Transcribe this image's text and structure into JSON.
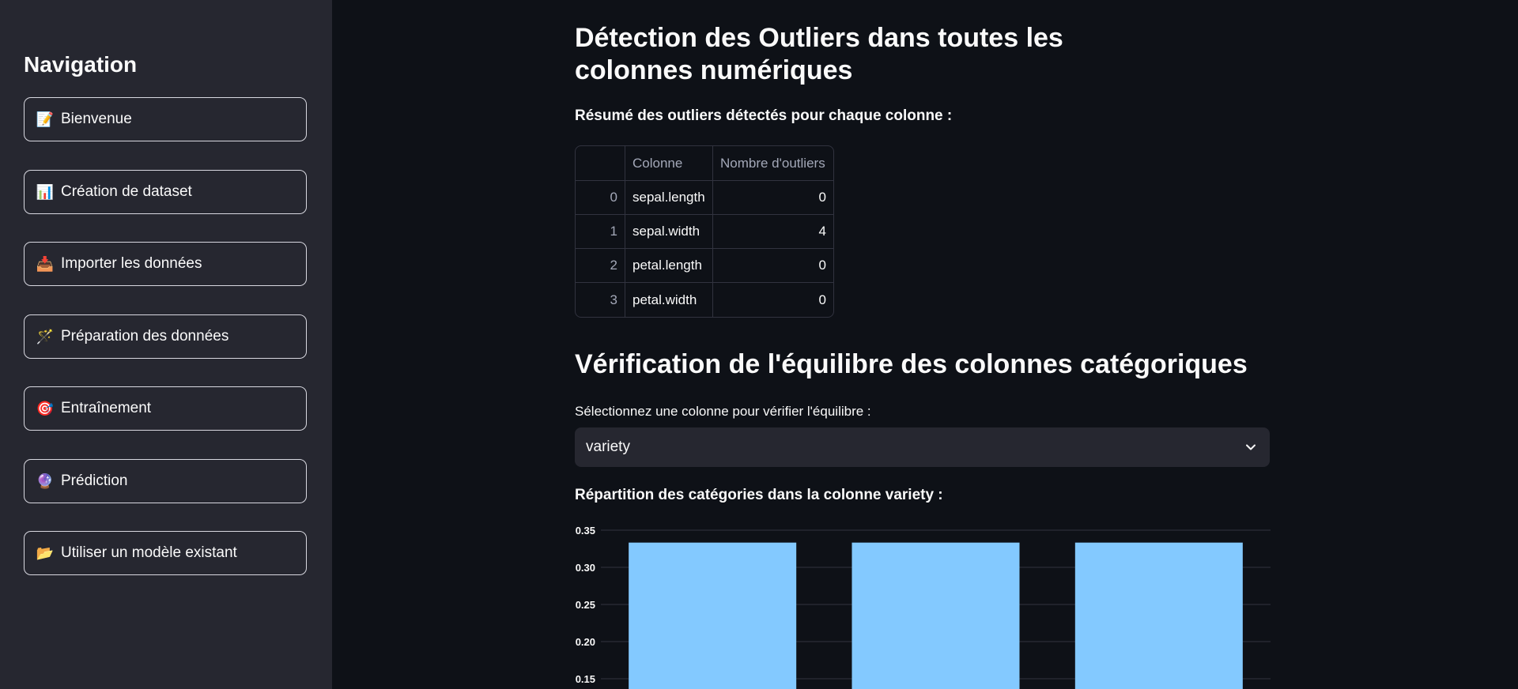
{
  "sidebar": {
    "title": "Navigation",
    "items": [
      {
        "icon": "📝",
        "icon_name": "memo-icon",
        "label": "Bienvenue"
      },
      {
        "icon": "📊",
        "icon_name": "bar-chart-icon",
        "label": "Création de dataset"
      },
      {
        "icon": "📥",
        "icon_name": "inbox-tray-icon",
        "label": "Importer les données"
      },
      {
        "icon": "🪄",
        "icon_name": "magic-wand-icon",
        "label": "Préparation des données"
      },
      {
        "icon": "🎯",
        "icon_name": "target-icon",
        "label": "Entraînement"
      },
      {
        "icon": "🔮",
        "icon_name": "crystal-ball-icon",
        "label": "Prédiction"
      },
      {
        "icon": "📂",
        "icon_name": "open-folder-icon",
        "label": "Utiliser un modèle existant"
      }
    ]
  },
  "main": {
    "title": "Détection des Outliers dans toutes les colonnes numériques",
    "summary_label": "Résumé des outliers détectés pour chaque colonne :",
    "table": {
      "headers": [
        "",
        "Colonne",
        "Nombre d'outliers"
      ],
      "rows": [
        [
          "0",
          "sepal.length",
          "0"
        ],
        [
          "1",
          "sepal.width",
          "4"
        ],
        [
          "2",
          "petal.length",
          "0"
        ],
        [
          "3",
          "petal.width",
          "0"
        ]
      ]
    },
    "section2_title": "Vérification de l'équilibre des colonnes catégoriques",
    "select_label": "Sélectionnez une colonne pour vérifier l'équilibre :",
    "select_value": "variety",
    "chart_title": "Répartition des catégories dans la colonne variety :"
  },
  "colors": {
    "background": "#0e1117",
    "sidebar": "#262730",
    "bar": "#83c9ff"
  },
  "chart_data": {
    "type": "bar",
    "categories": [
      "",
      "",
      ""
    ],
    "values": [
      0.3333,
      0.3333,
      0.3333
    ],
    "yticks": [
      "0.35",
      "0.30",
      "0.25",
      "0.20",
      "0.15"
    ],
    "ylim": [
      0.15,
      0.35
    ],
    "grid": true,
    "color": "#83c9ff"
  }
}
